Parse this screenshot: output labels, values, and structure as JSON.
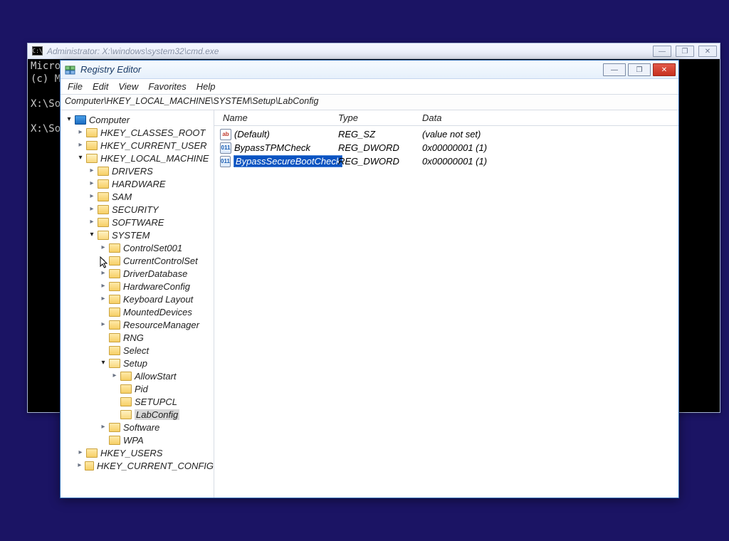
{
  "cmd": {
    "title": "Administrator: X:\\windows\\system32\\cmd.exe",
    "lines": {
      "l1": "Micro",
      "l2": "(c) M",
      "l3": "",
      "l4": "X:\\So",
      "l5": "",
      "l6": "X:\\So"
    }
  },
  "regedit": {
    "title": "Registry Editor",
    "menu": {
      "file": "File",
      "edit": "Edit",
      "view": "View",
      "fav": "Favorites",
      "help": "Help"
    },
    "address": "Computer\\HKEY_LOCAL_MACHINE\\SYSTEM\\Setup\\LabConfig",
    "columns": {
      "name": "Name",
      "type": "Type",
      "data": "Data"
    },
    "values": [
      {
        "icon": "ab",
        "name": "(Default)",
        "type": "REG_SZ",
        "data": "(value not set)",
        "selected": false
      },
      {
        "icon": "bin",
        "name": "BypassTPMCheck",
        "type": "REG_DWORD",
        "data": "0x00000001 (1)",
        "selected": false
      },
      {
        "icon": "bin",
        "name": "BypassSecureBootCheck",
        "type": "REG_DWORD",
        "data": "0x00000001 (1)",
        "selected": true
      }
    ],
    "tree": {
      "root": "Computer",
      "hkcr": "HKEY_CLASSES_ROOT",
      "hkcu": "HKEY_CURRENT_USER",
      "hklm": "HKEY_LOCAL_MACHINE",
      "drivers": "DRIVERS",
      "hardware": "HARDWARE",
      "sam": "SAM",
      "security": "SECURITY",
      "software": "SOFTWARE",
      "system": "SYSTEM",
      "cs001": "ControlSet001",
      "ccs": "CurrentControlSet",
      "drvdb": "DriverDatabase",
      "hwcfg": "HardwareConfig",
      "kbd": "Keyboard Layout",
      "mdev": "MountedDevices",
      "resmgr": "ResourceManager",
      "rng": "RNG",
      "select": "Select",
      "setup": "Setup",
      "allowstart": "AllowStart",
      "pid": "Pid",
      "setupcl": "SETUPCL",
      "labconfig": "LabConfig",
      "softw2": "Software",
      "wpa": "WPA",
      "hku": "HKEY_USERS",
      "hkcc": "HKEY_CURRENT_CONFIG"
    }
  },
  "winbtn": {
    "min": "—",
    "max": "❐",
    "close": "✕",
    "restore": "❐"
  }
}
